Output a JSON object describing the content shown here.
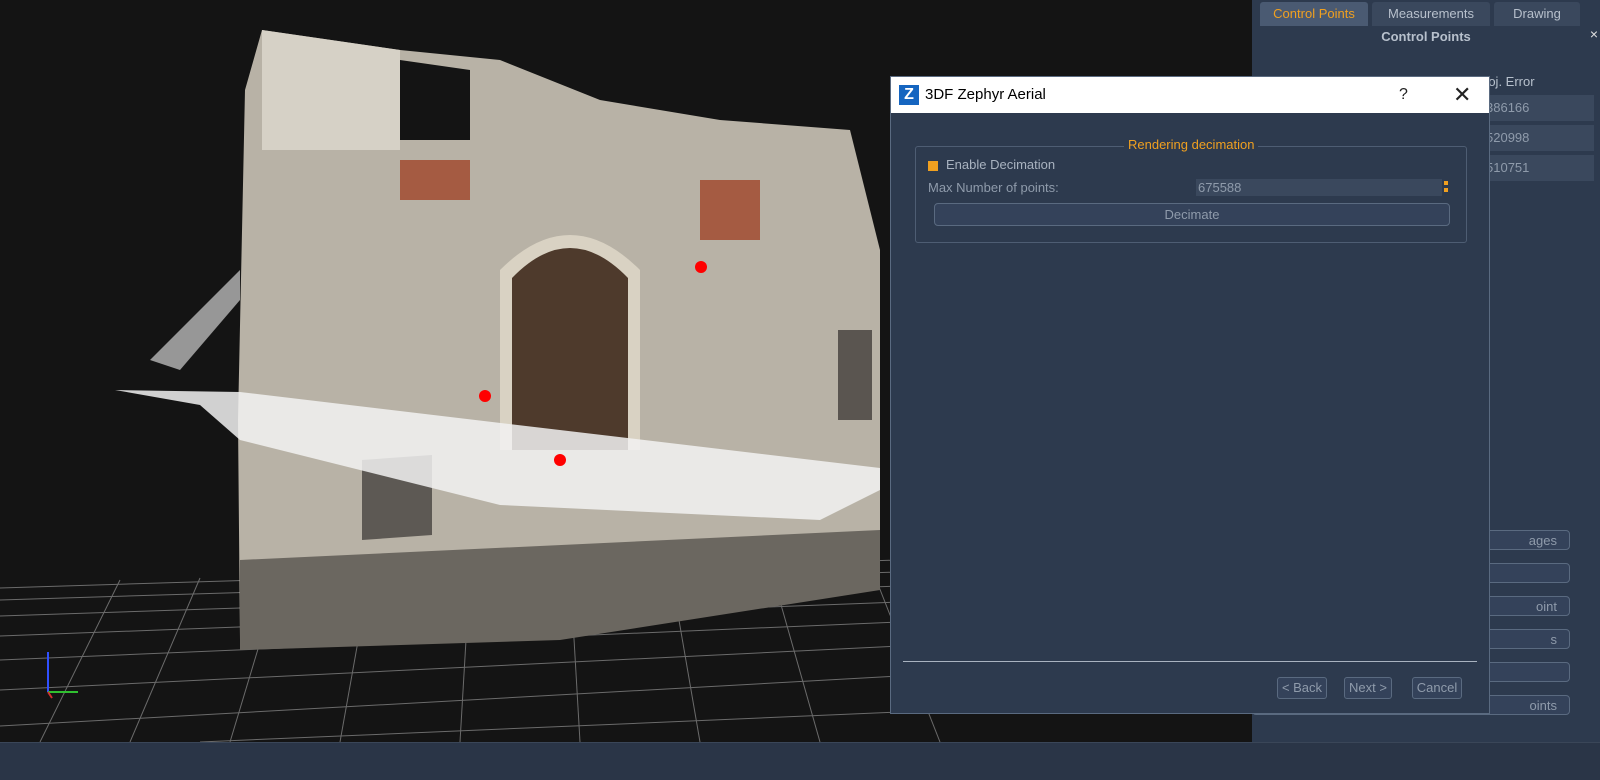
{
  "right_panel": {
    "tabs": [
      "Control Points",
      "Measurements",
      "Drawing"
    ],
    "active_tab": "Control Points",
    "title": "Control Points",
    "close_glyph": "×",
    "column_header": "roj. Error",
    "errors": [
      "386166",
      "520998",
      "510751"
    ],
    "buttons": [
      "ages",
      "",
      "oint",
      "s",
      "",
      "oints"
    ]
  },
  "dialog": {
    "title": "3DF Zephyr Aerial",
    "logo": "Z",
    "help_glyph": "?",
    "close_glyph": "✕",
    "group_title": "Rendering decimation",
    "enable_label": "Enable Decimation",
    "enable_checked": true,
    "max_points_label": "Max Number of points:",
    "max_points_value": "675588",
    "decimate_label": "Decimate",
    "back_label": "< Back",
    "next_label": "Next >",
    "cancel_label": "Cancel"
  },
  "colors": {
    "accent": "#f0a020",
    "panel_bg": "#2d3a4e",
    "viewport_bg": "#141414",
    "marker": "#ff0000"
  },
  "icons": {
    "axis_gizmo": "axis-gizmo-icon",
    "dialog_logo": "zephyr-logo-icon"
  }
}
